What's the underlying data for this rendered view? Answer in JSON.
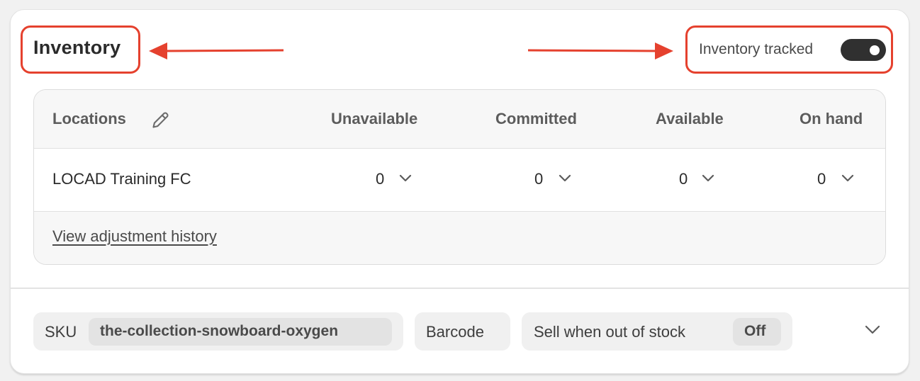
{
  "inventory": {
    "title": "Inventory",
    "tracked_label": "Inventory tracked",
    "tracked_on": true
  },
  "table": {
    "headers": {
      "locations": "Locations",
      "unavailable": "Unavailable",
      "committed": "Committed",
      "available": "Available",
      "on_hand": "On hand"
    },
    "row": {
      "location": "LOCAD Training FC",
      "unavailable": "0",
      "committed": "0",
      "available": "0",
      "on_hand": "0"
    },
    "history_link": "View adjustment history"
  },
  "footer": {
    "sku_label": "SKU",
    "sku_value": "the-collection-snowboard-oxygen",
    "barcode_label": "Barcode",
    "sell_oos_label": "Sell when out of stock",
    "sell_oos_value": "Off"
  },
  "icons": {
    "edit": "pencil-icon",
    "dropdown": "chevron-down-icon",
    "expand": "chevron-down-icon",
    "annotation_arrow": "arrow-icon"
  },
  "colors": {
    "annotation": "#e5412e",
    "toggle_on": "#303030"
  }
}
